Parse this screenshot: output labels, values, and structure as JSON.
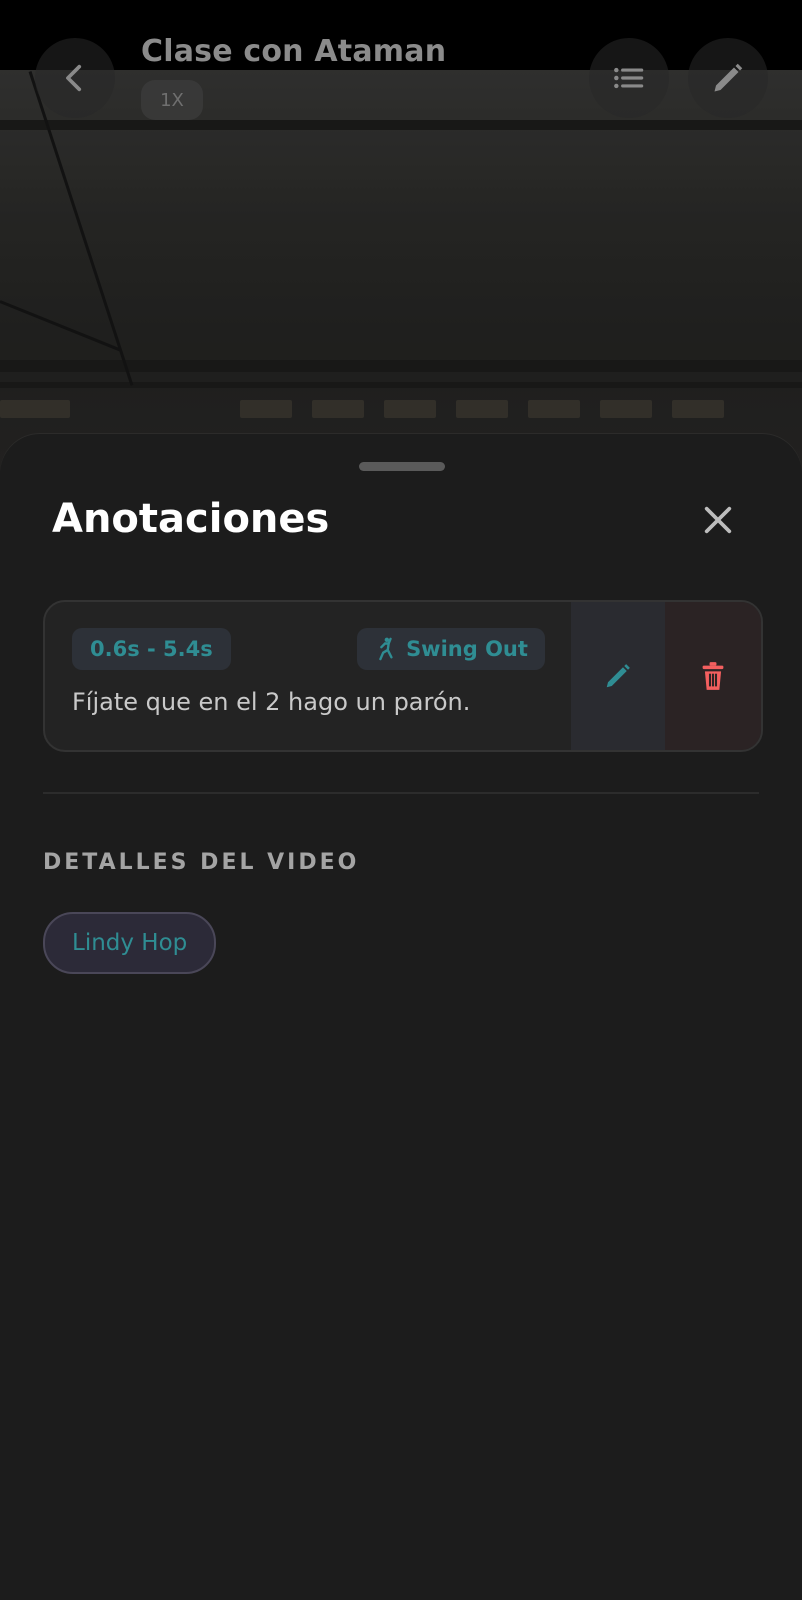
{
  "video": {
    "title": "Clase con Ataman",
    "speed": "1X"
  },
  "top_bar": {
    "back_icon": "chevron-left-icon",
    "list_icon": "list-icon",
    "edit_icon": "pencil-icon"
  },
  "sheet": {
    "title": "Anotaciones",
    "close_icon": "close-icon"
  },
  "annotations": [
    {
      "time_range": "0.6s - 5.4s",
      "move": "Swing Out",
      "move_icon": "dancer-icon",
      "note": "Fíjate que en el 2 hago un parón.",
      "edit_icon": "pencil-icon",
      "delete_icon": "trash-icon"
    }
  ],
  "details": {
    "section_title": "DETALLES DEL VIDEO",
    "tags": [
      "Lindy Hop"
    ]
  },
  "colors": {
    "accent": "#2f8d93",
    "danger": "#f35f5f",
    "sheet_bg": "#1c1c1c"
  }
}
